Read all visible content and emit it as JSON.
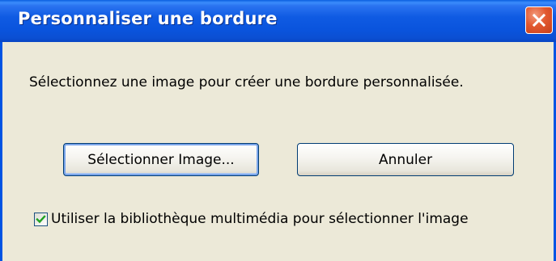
{
  "window": {
    "title": "Personnaliser une bordure"
  },
  "dialog": {
    "message": "Sélectionnez une image pour créer une bordure personnalisée.",
    "select_button_label": "Sélectionner Image...",
    "cancel_button_label": "Annuler",
    "checkbox": {
      "label": "Utiliser la bibliothèque multimédia pour sélectionner l'image",
      "checked": true
    }
  },
  "icons": {
    "close": "close-icon",
    "check": "checkmark-icon"
  },
  "colors": {
    "titlebar_blue": "#0a54dd",
    "close_red": "#e2582f",
    "window_bg": "#ece9d8",
    "check_green": "#21a121"
  }
}
